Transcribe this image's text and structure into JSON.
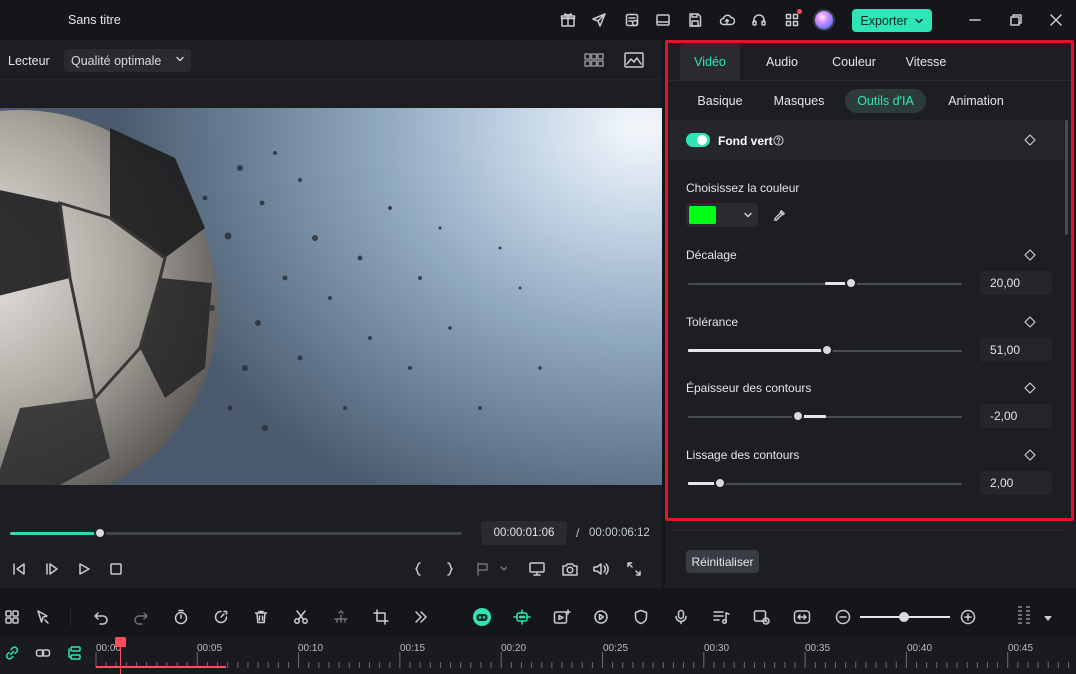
{
  "app": {
    "title": "Sans titre",
    "export_label": "Exporter"
  },
  "player": {
    "label": "Lecteur",
    "quality": "Qualité optimale",
    "current_time": "00:00:01:06",
    "separator": "/",
    "total_time": "00:00:06:12",
    "progress_fraction": 0.2
  },
  "properties": {
    "tabs": [
      {
        "label": "Vidéo",
        "active": true
      },
      {
        "label": "Audio",
        "active": false
      },
      {
        "label": "Couleur",
        "active": false
      },
      {
        "label": "Vitesse",
        "active": false
      }
    ],
    "subtabs": [
      {
        "label": "Basique",
        "active": false
      },
      {
        "label": "Masques",
        "active": false
      },
      {
        "label": "Outils d'IA",
        "active": true
      },
      {
        "label": "Animation",
        "active": false
      }
    ],
    "green_screen": {
      "label": "Fond vert",
      "enabled": true,
      "color_label": "Choisissez la couleur",
      "color": "#00ff14"
    },
    "sliders": [
      {
        "label": "Décalage",
        "value": "20,00"
      },
      {
        "label": "Tolérance",
        "value": "51,00"
      },
      {
        "label": "Épaisseur des contours",
        "value": "-2,00"
      },
      {
        "label": "Lissage des contours",
        "value": "2,00"
      }
    ],
    "reset_label": "Réinitialiser"
  },
  "timeline": {
    "ruler_labels": [
      "00:00",
      "00:05",
      "00:10",
      "00:15",
      "00:20",
      "00:25",
      "00:30",
      "00:35",
      "00:40",
      "00:45"
    ]
  },
  "colors": {
    "accent": "#2ee6b5",
    "highlight": "#e0142a",
    "playhead": "#ff4d5a"
  }
}
